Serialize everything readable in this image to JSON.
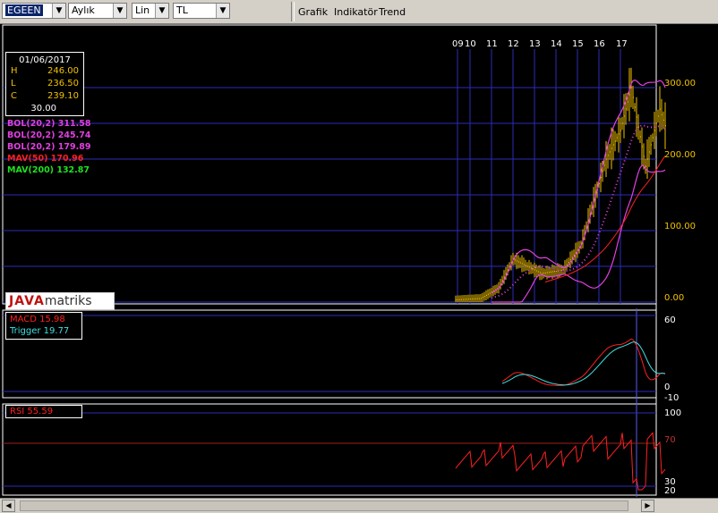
{
  "toolbar": {
    "symbol": "EGEEN",
    "period": "Aylık",
    "scale": "Lin",
    "currency": "TL",
    "menu": [
      "Grafik",
      "Indikatör",
      "Trend"
    ]
  },
  "ohlc": {
    "date": "01/06/2017",
    "h_label": "H",
    "h_value": "246.00",
    "l_label": "L",
    "l_value": "236.50",
    "c_label": "C",
    "c_value": "239.10",
    "volume": "30.00"
  },
  "indicators": [
    {
      "text": "BOL(20,2) 311.58",
      "color": "#e040e0"
    },
    {
      "text": "BOL(20,2) 245.74",
      "color": "#e040e0"
    },
    {
      "text": "BOL(20,2) 179.89",
      "color": "#e040e0"
    },
    {
      "text": "MAV(50) 170.96",
      "color": "#ff2020"
    },
    {
      "text": "MAV(200) 132.87",
      "color": "#20e020"
    }
  ],
  "logo": {
    "part1": "JAVA",
    "part2": "matriks"
  },
  "price_axis": [
    "300.00",
    "200.00",
    "100.00",
    "0.00"
  ],
  "year_labels": [
    "09",
    "10",
    "11",
    "12",
    "13",
    "14",
    "15",
    "16",
    "17"
  ],
  "macd": {
    "macd_label": "MACD 15.98",
    "trigger_label": "Trigger 19.77",
    "axis": [
      "60",
      "0",
      "-10"
    ]
  },
  "rsi": {
    "label": "RSI 55.59",
    "axis": [
      "100",
      "70",
      "30",
      "20"
    ]
  },
  "colors": {
    "candle": "#f2c200",
    "grid": "#2b2bb8",
    "bol": "#e040e0",
    "mav50": "#ff2020",
    "trigger": "#40e0e0"
  }
}
